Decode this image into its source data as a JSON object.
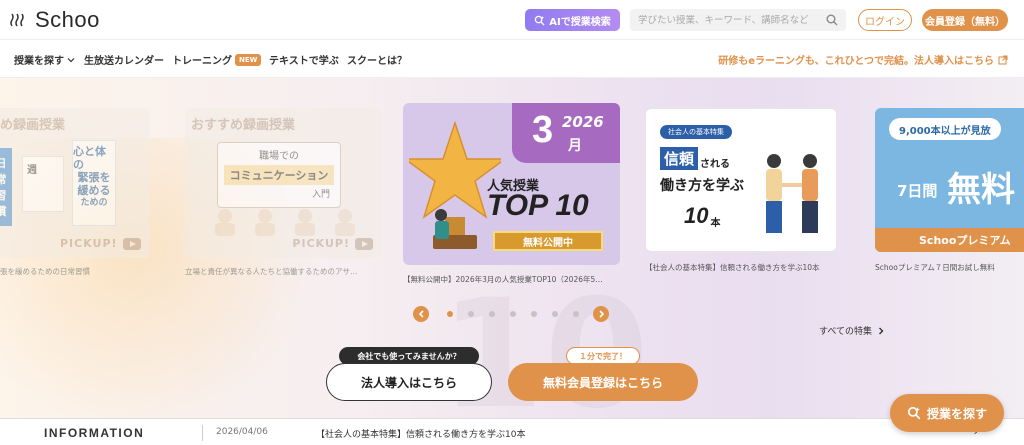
{
  "header": {
    "logo_text": "Schoo",
    "ai_search_label": "AIで授業検索",
    "search_placeholder": "学びたい授業、キーワード、講師名など",
    "login_label": "ログイン",
    "signup_label": "会員登録（無料）"
  },
  "nav": {
    "items": [
      {
        "label": "授業を探す",
        "has_chevron": true
      },
      {
        "label": "生放送カレンダー"
      },
      {
        "label": "トレーニング",
        "badge": "NEW"
      },
      {
        "label": "テキストで学ぶ"
      },
      {
        "label": "スクーとは？"
      }
    ],
    "promo": "研修もeラーニングも、これひとつで完結。法人導入はこちら"
  },
  "carousel": {
    "slides": [
      {
        "heading": "め録画授業",
        "book_lines": [
          "心と体の",
          "緊張を",
          "緩める",
          "ための"
        ],
        "side_chars": [
          "日",
          "常",
          "習",
          "慣"
        ],
        "memo_text": "週",
        "badge": "PICKUP!",
        "caption": "張を緩めるための日常習慣"
      },
      {
        "heading": "おすすめ録画授業",
        "board_line1": "職場での",
        "board_line2": "コミュニケーション",
        "board_line3": "入門",
        "badge": "PICKUP!",
        "caption": "立場と責任が異なる人たちと協働するためのアサ…"
      },
      {
        "year": "2026",
        "month": "3",
        "month_unit": "月",
        "subtitle": "人気授業",
        "title": "TOP 10",
        "ribbon": "無料公開中",
        "caption": "【無料公開中】2026年3月の人気授業TOP10（2026年5…"
      },
      {
        "tag": "社会人の基本特集",
        "line1_big": "信頼",
        "line1_small": "される",
        "line2": "働き方を学ぶ",
        "count": "10",
        "count_unit": "本",
        "caption": "【社会人の基本特集】信頼される働き方を学ぶ10本"
      },
      {
        "top_banner": "9,000本以上が見放",
        "days": "7日間",
        "big": "無料",
        "footer": "Schooプレミアム",
        "caption": "Schooプレミアム７日間お試し無料"
      }
    ],
    "dots": 7,
    "active_dot": 1,
    "all_features": "すべての特集"
  },
  "cta": {
    "corp_bubble": "会社でも使ってみませんか？",
    "corp_label": "法人導入はこちら",
    "free_bubble": "１分で完了！",
    "free_label": "無料会員登録はこちら"
  },
  "info": {
    "label": "INFORMATION",
    "date": "2026/04/06",
    "text": "【社会人の基本特集】信頼される働き方を学ぶ10本"
  },
  "floating": {
    "label": "授業を探す"
  },
  "colors": {
    "accent": "#e0914a",
    "ai_gradient_start": "#8f7cf0",
    "ai_gradient_end": "#b48cf0"
  }
}
